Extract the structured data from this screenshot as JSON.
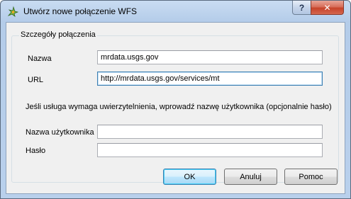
{
  "window": {
    "title": "Utwórz nowe połączenie WFS",
    "help_label": "?",
    "close_label": "✕",
    "app_icon": "qgis-logo-icon"
  },
  "connection": {
    "group_title": "Szczegóły połączenia",
    "name_label": "Nazwa",
    "name_value": "mrdata.usgs.gov",
    "url_label": "URL",
    "url_value": "http://mrdata.usgs.gov/services/mt",
    "auth_note": "Jeśli usługa wymaga uwierzytelnienia, wprowadź nazwę użytkownika (opcjonalnie hasło)",
    "username_label": "Nazwa użytkownika",
    "username_value": "",
    "password_label": "Hasło",
    "password_value": ""
  },
  "buttons": {
    "ok": "OK",
    "cancel": "Anuluj",
    "help": "Pomoc"
  },
  "colors": {
    "titlebar": "#b9d0ec",
    "close_button": "#c7432a",
    "dialog_bg": "#f0f0f0",
    "focus_border": "#3c7fb1"
  }
}
